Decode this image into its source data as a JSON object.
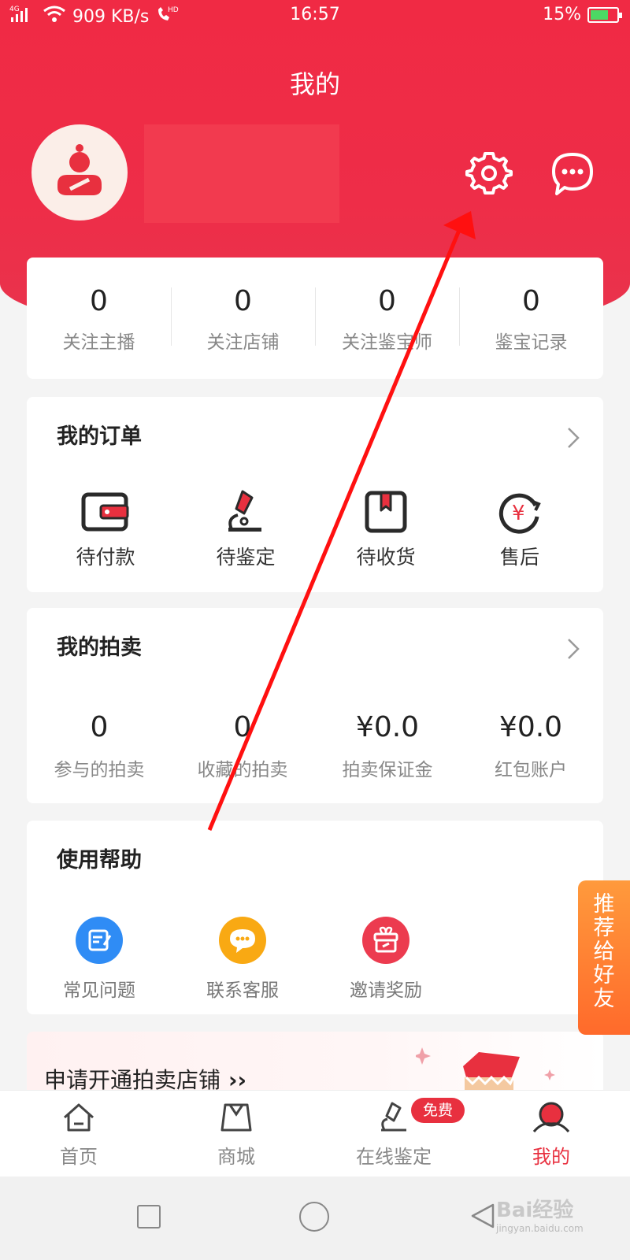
{
  "status_bar": {
    "network": "4G",
    "speed": "909 KB/s",
    "hd": "HD",
    "time": "16:57",
    "battery": "15%"
  },
  "page_title": "我的",
  "stats": [
    {
      "value": "0",
      "label": "关注主播"
    },
    {
      "value": "0",
      "label": "关注店铺"
    },
    {
      "value": "0",
      "label": "关注鉴宝师"
    },
    {
      "value": "0",
      "label": "鉴宝记录"
    }
  ],
  "orders": {
    "title": "我的订单",
    "items": [
      {
        "label": "待付款",
        "icon": "wallet-icon"
      },
      {
        "label": "待鉴定",
        "icon": "microscope-icon"
      },
      {
        "label": "待收货",
        "icon": "package-icon"
      },
      {
        "label": "售后",
        "icon": "refund-icon"
      }
    ]
  },
  "auction": {
    "title": "我的拍卖",
    "items": [
      {
        "value": "0",
        "label": "参与的拍卖"
      },
      {
        "value": "0",
        "label": "收藏的拍卖"
      },
      {
        "value": "¥0.0",
        "label": "拍卖保证金"
      },
      {
        "value": "¥0.0",
        "label": "红包账户"
      }
    ]
  },
  "help": {
    "title": "使用帮助",
    "items": [
      {
        "label": "常见问题",
        "icon": "faq-icon",
        "color": "#2f8cf5"
      },
      {
        "label": "联系客服",
        "icon": "chat-bubble-icon",
        "color": "#f9a913"
      },
      {
        "label": "邀请奖励",
        "icon": "gift-icon",
        "color": "#ec3b4f"
      }
    ]
  },
  "promo": {
    "text": "申请开通拍卖店铺",
    "arrows": "››"
  },
  "share_tab": [
    "推",
    "荐",
    "给",
    "好",
    "友"
  ],
  "tabs": [
    {
      "label": "首页",
      "icon": "home-icon"
    },
    {
      "label": "商城",
      "icon": "shopping-bag-icon"
    },
    {
      "label": "在线鉴定",
      "icon": "microscope-icon"
    },
    {
      "label": "我的",
      "icon": "profile-icon",
      "active": true
    }
  ],
  "free_badge": "免费",
  "watermark": {
    "main": "Bai经验",
    "sub": "jingyan.baidu.com"
  },
  "colors": {
    "brand_red": "#ee2d48",
    "accent_orange": "#ff7a2f"
  }
}
